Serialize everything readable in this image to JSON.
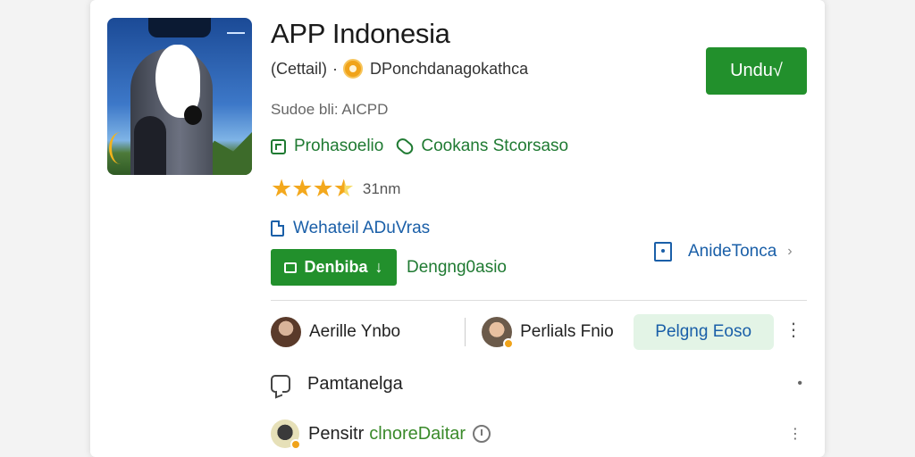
{
  "app": {
    "title": "APP Indonesia",
    "detail_label": "(Cettail)",
    "separator": "·",
    "developer": "DPonchdanagokathca",
    "subline": "Sudoe bli: AICPD",
    "install_label": "Undu√"
  },
  "tags": {
    "first": "Prohasoelio",
    "second": "Cookans Stcorsaso"
  },
  "rating": {
    "stars_value": 3.5,
    "stars_max": 4,
    "count_label": "31nm"
  },
  "links": {
    "website": "Wehateil ADuVras",
    "side": "AnideTonca",
    "side_chevron": "›"
  },
  "actions": {
    "download_label": "Denbiba",
    "download_arrow": "↓",
    "status_text": "Dengng0asio"
  },
  "users": [
    {
      "name": "Aerille Ynbo"
    },
    {
      "name": "Perlials Fnio"
    }
  ],
  "pill_button": "Pelgng Eoso",
  "kebab": "⋮",
  "list": [
    {
      "label": "Pamtanelga",
      "more": "•"
    },
    {
      "label": "Pensitr",
      "label_green": "clnoreDaitar",
      "more": "⋮"
    }
  ],
  "colors": {
    "accent_green": "#22902c",
    "link_blue": "#1a5fa8",
    "star": "#f3a81d",
    "pill_bg": "#e3f4e6"
  }
}
